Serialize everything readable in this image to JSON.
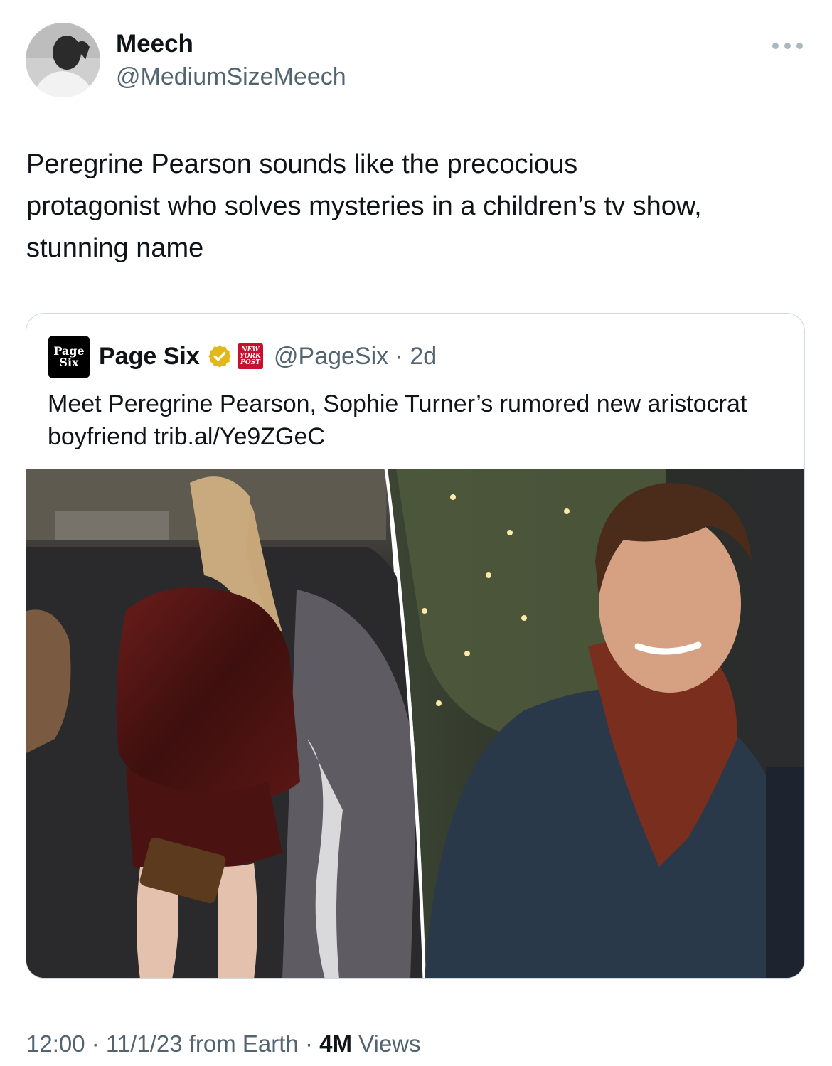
{
  "author": {
    "display_name": "Meech",
    "handle": "@MediumSizeMeech"
  },
  "tweet": {
    "text": "Peregrine Pearson sounds like the precocious\nprotagonist who solves mysteries in a children’s tv show,\nstunning name"
  },
  "quoted_tweet": {
    "logo_line1": "Page",
    "logo_line2": "Six",
    "display_name": "Page Six",
    "affiliate_badge_line1": "NEW",
    "affiliate_badge_line2": "YORK",
    "affiliate_badge_line3": "POST",
    "handle": "@PageSix",
    "separator": " · ",
    "age": "2d",
    "text": "Meet Peregrine Pearson, Sophie Turner’s rumored new aristocrat boyfriend ",
    "link": "trib.al/Ye9ZGeC",
    "verified_icon": "gold-verified-badge-icon"
  },
  "footer": {
    "time": "12:00",
    "sep1": " · ",
    "date": "11/1/23",
    "source": " from Earth",
    "sep2": " · ",
    "views_count": "4M",
    "views_label": " Views"
  },
  "colors": {
    "text_primary": "#0f1419",
    "text_secondary": "#536471",
    "border": "#cfd9de",
    "verified_gold": "#e2b719",
    "nyp_red": "#c8102e"
  }
}
